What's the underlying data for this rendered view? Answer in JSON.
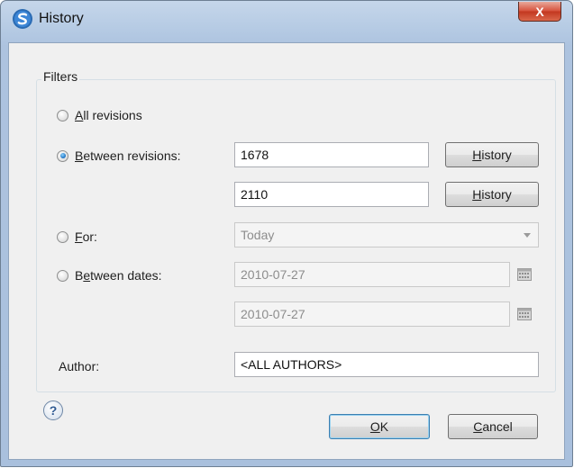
{
  "window": {
    "title": "History",
    "close_label": "X",
    "icon": "app-logo-icon"
  },
  "filters": {
    "legend": "Filters",
    "all_revisions": {
      "prefix": "",
      "mnemonic": "A",
      "suffix": "ll revisions",
      "checked": false
    },
    "between_revisions": {
      "prefix": "",
      "mnemonic": "B",
      "suffix": "etween revisions:",
      "checked": true,
      "from_value": "1678",
      "to_value": "2110",
      "history_button": {
        "prefix": "",
        "mnemonic": "H",
        "suffix": "istory"
      }
    },
    "for": {
      "prefix": "",
      "mnemonic": "F",
      "suffix": "or:",
      "checked": false,
      "selected": "Today"
    },
    "between_dates": {
      "prefix": "B",
      "mnemonic": "e",
      "suffix": "tween dates:",
      "checked": false,
      "from_date": "2010-07-27",
      "to_date": "2010-07-27",
      "calendar_icon": "calendar-icon"
    },
    "author": {
      "label": "Author:",
      "value": "<ALL AUTHORS>"
    }
  },
  "footer": {
    "help_icon": "help-icon",
    "help_glyph": "?",
    "ok": {
      "prefix": "",
      "mnemonic": "O",
      "suffix": "K"
    },
    "cancel": {
      "prefix": "",
      "mnemonic": "C",
      "suffix": "ancel"
    }
  },
  "colors": {
    "frame": "#b6cbe4",
    "client": "#f0f0f0",
    "close_button": "#d7533d",
    "radio_checked": "#1a6fc0"
  }
}
